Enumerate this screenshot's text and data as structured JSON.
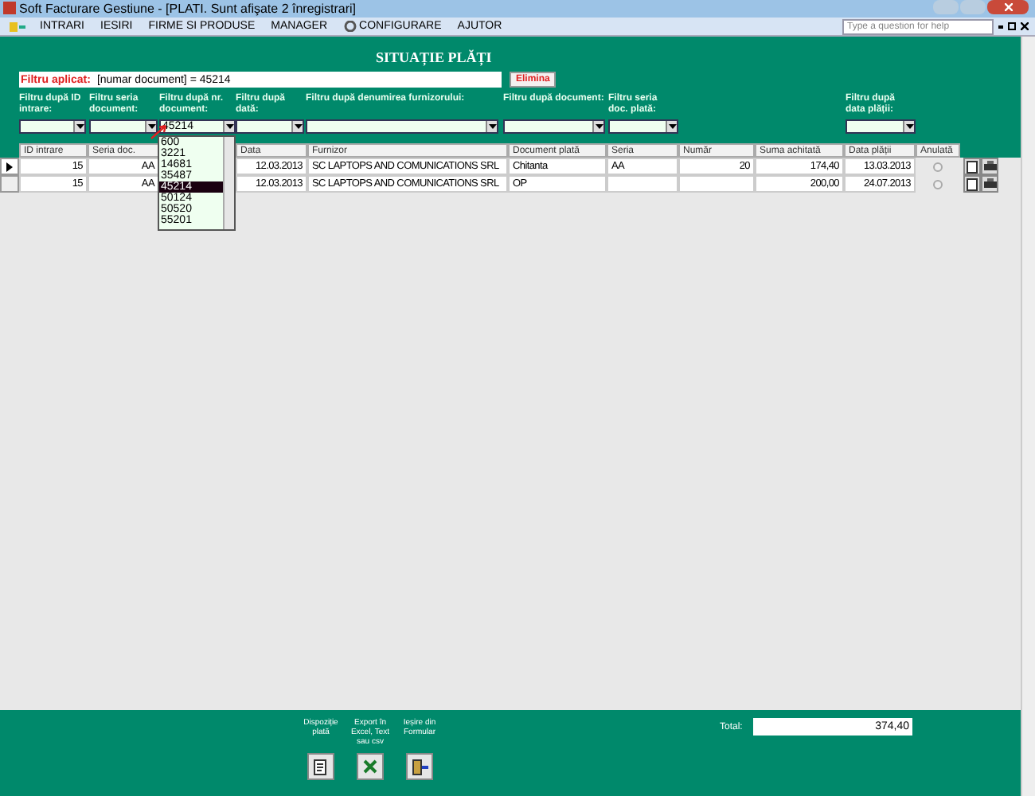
{
  "window": {
    "title": "Soft Facturare Gestiune - [PLATI. Sunt afişate 2 înregistrari]",
    "help_placeholder": "Type a question for help"
  },
  "menu": [
    {
      "label": "INTRARI",
      "kind": "text"
    },
    {
      "label": "IESIRI",
      "kind": "text"
    },
    {
      "label": "FIRME SI PRODUSE",
      "kind": "text"
    },
    {
      "label": "MANAGER",
      "kind": "text"
    },
    {
      "label": "CONFIGURARE",
      "kind": "gear"
    },
    {
      "label": "AJUTOR",
      "kind": "text"
    }
  ],
  "form_title": "SITUAȚIE PLĂȚI",
  "applied_filter": {
    "label": "Filtru aplicat:",
    "value": "[numar document] = 45214",
    "button": "Elimina"
  },
  "filters": [
    {
      "label": "Filtru după ID intrare:"
    },
    {
      "label": "Filtru seria document:"
    },
    {
      "label": "Filtru după nr. document:",
      "value": "45214"
    },
    {
      "label": "Filtru după dată:"
    },
    {
      "label": "Filtru după denumirea furnizorului:"
    },
    {
      "label": "Filtru după document:"
    },
    {
      "label": "Filtru seria doc. plată:"
    },
    {
      "label": "Filtru după data plății:"
    }
  ],
  "dropdown": {
    "items": [
      {
        "label": "600",
        "selected": false
      },
      {
        "label": "3221",
        "selected": false
      },
      {
        "label": "14681",
        "selected": false
      },
      {
        "label": "35487",
        "selected": false
      },
      {
        "label": "45214",
        "selected": true
      },
      {
        "label": "50124",
        "selected": false
      },
      {
        "label": "50520",
        "selected": false
      },
      {
        "label": "55201",
        "selected": false
      }
    ]
  },
  "table": {
    "columns": [
      "ID intrare",
      "Seria doc.",
      "",
      "Data",
      "Furnizor",
      "Document plată",
      "Seria",
      "Număr",
      "Suma achitată",
      "Data plății",
      "Anulată"
    ],
    "rows": [
      {
        "current": true,
        "cells": [
          "15",
          "AA",
          "",
          "12.03.2013",
          "SC LAPTOPS AND COMUNICATIONS SRL",
          "Chitanta",
          "AA",
          "20",
          "174,40",
          "13.03.2013"
        ],
        "cancelled": false
      },
      {
        "current": false,
        "cells": [
          "15",
          "AA",
          "",
          "12.03.2013",
          "SC LAPTOPS AND COMUNICATIONS SRL",
          "OP",
          "",
          "",
          "200,00",
          "24.07.2013"
        ],
        "cancelled": false
      }
    ]
  },
  "footer": {
    "buttons": [
      {
        "label": "Dispoziție plată",
        "kind": "doc"
      },
      {
        "label": "Export în Excel, Text sau csv",
        "kind": "excel"
      },
      {
        "label": "Ieșire din Formular",
        "kind": "exit"
      }
    ],
    "total_label": "Total:",
    "total": "374,40"
  }
}
